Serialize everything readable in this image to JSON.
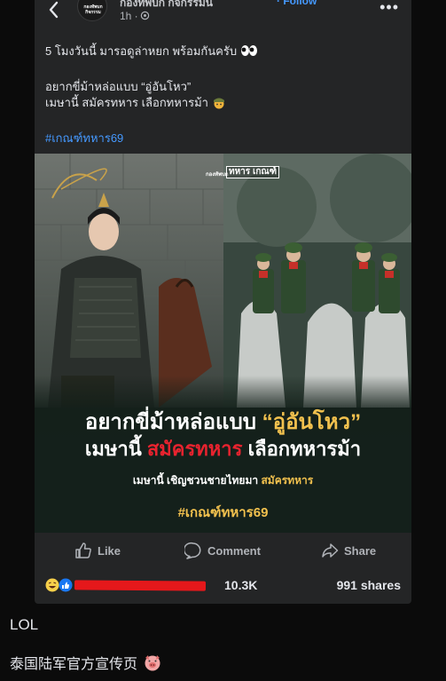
{
  "header": {
    "page_name": "กองทัพบก กิจกรรมน",
    "follow_label": "· Follow",
    "time": "1h ·",
    "avatar_text": "กองทัพบก กิจกรรม"
  },
  "post": {
    "line1": "5 โมงวันนี้ มารอดูล่าหยก พร้อมกันครับ",
    "line2": "อยากขี่ม้าหล่อแบบ “อู่อันโหว”",
    "line3": "เมษานี้ สมัครทหาร เลือกทหารม้า",
    "hashtag": "#เกณฑ์ทหาร69"
  },
  "media": {
    "headline1_a": "อยากขี่ม้าหล่อแบบ ",
    "headline1_b": "“อู่อันโหว”",
    "headline2_a": "เมษานี้ ",
    "headline2_b": "สมัครทหาร",
    "headline2_c": " เลือกทหารม้า",
    "subline_a": "เมษานี้ เชิญชวนชายไทยมา ",
    "subline_b": "สมัครทหาร",
    "hashtag": "#เกณฑ์ทหาร69",
    "logo_small": "กองทัพบก",
    "logo_big": "ทหาร เกณฑ์"
  },
  "actions": {
    "like": "Like",
    "comment": "Comment",
    "share": "Share"
  },
  "stats": {
    "reactions_count": "10.3K",
    "shares": "991 shares"
  },
  "comments": {
    "c1": "LOL",
    "c2": "泰国陆军官方宣传页"
  },
  "colors": {
    "background": "#0b0b0b",
    "card": "#242526",
    "link_blue": "#4599ff",
    "gold": "#f2c14e",
    "red": "#e8232f"
  }
}
